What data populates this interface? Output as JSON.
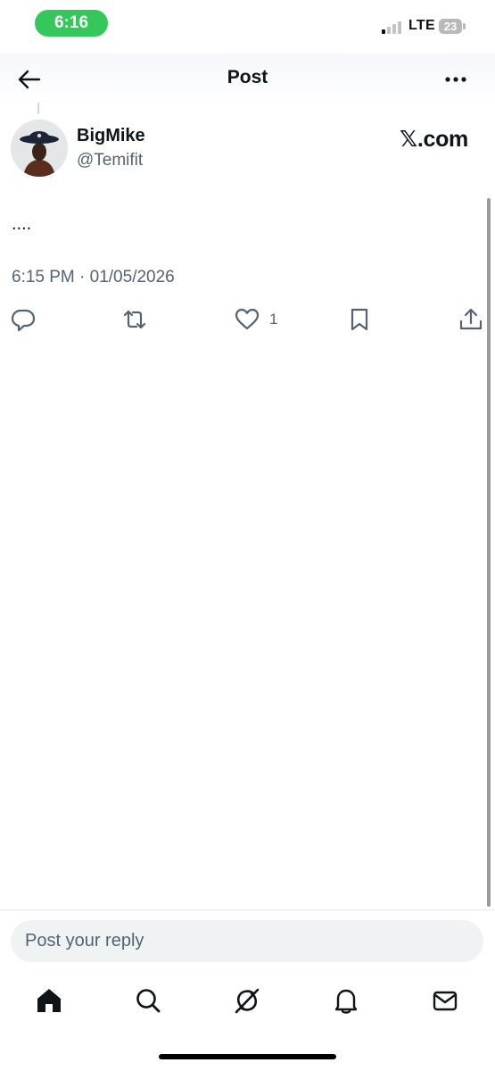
{
  "status_bar": {
    "time": "6:16",
    "network": "LTE",
    "battery": "23"
  },
  "header": {
    "title": "Post"
  },
  "post": {
    "author_name": "BigMike",
    "author_handle": "@Temifit",
    "source_label": "𝕏.com",
    "text": "....",
    "timestamp": "6:15 PM · 01/05/2026",
    "like_count": "1"
  },
  "reply": {
    "placeholder": "Post your reply"
  },
  "icons": [
    "back-arrow-icon",
    "more-icon",
    "reply-icon",
    "repost-icon",
    "like-icon",
    "bookmark-icon",
    "share-icon",
    "home-icon",
    "search-icon",
    "grok-icon",
    "notifications-icon",
    "messages-icon"
  ],
  "colors": {
    "status_time_pill": "#34c759",
    "secondary_text": "#536471",
    "reply_box_bg": "#eff3f4"
  }
}
